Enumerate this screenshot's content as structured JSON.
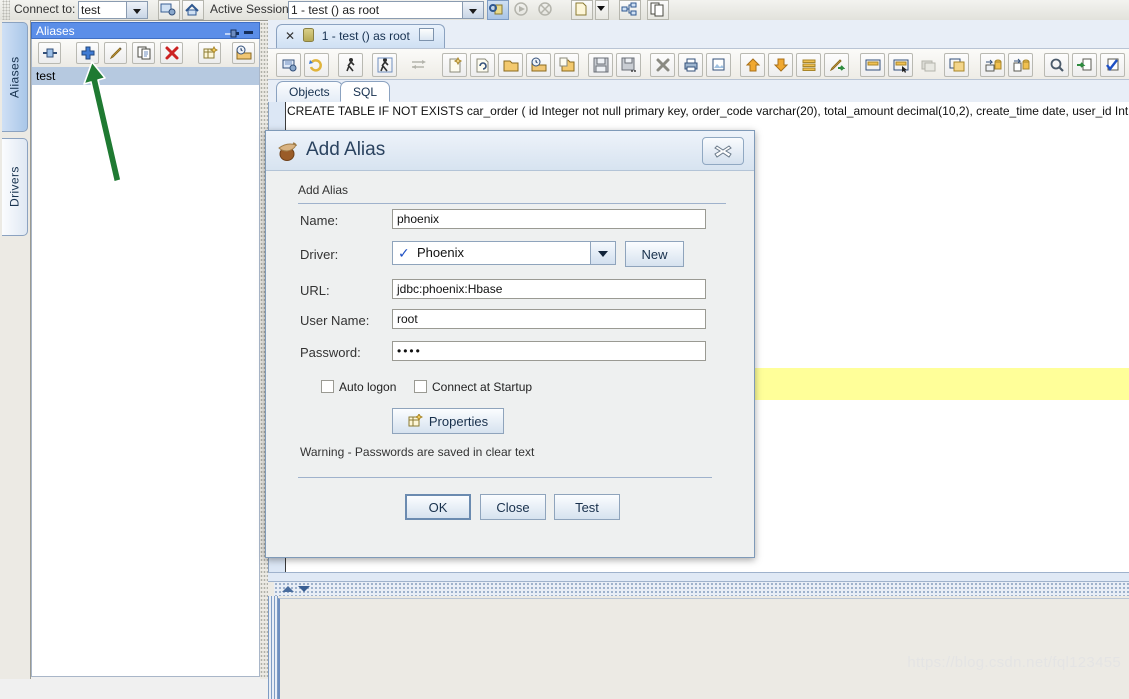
{
  "topbar": {
    "connect_label": "Connect to:",
    "connect_value": "test",
    "session_label": "Active Session:",
    "session_value": "1 - test () as root",
    "icons": [
      "connect-new-icon",
      "reconnect-icon",
      "run-icon",
      "stop-icon",
      "new-file-icon",
      "dropdown-icon",
      "hierarchy-icon",
      "copy-icon"
    ]
  },
  "vertical_tabs": [
    {
      "label": "Aliases",
      "selected": true
    },
    {
      "label": "Drivers",
      "selected": false
    }
  ],
  "aliases_panel": {
    "title": "Aliases",
    "pin_icon": "pin-icon",
    "minimize_icon": "minimize-icon",
    "toolbar_icons": [
      "connect-alias-icon",
      "add-alias-icon",
      "modify-alias-icon",
      "copy-alias-icon",
      "delete-alias-icon",
      "new-table-icon",
      "open-recent-icon"
    ],
    "items": [
      {
        "label": "test",
        "selected": true
      }
    ]
  },
  "editor": {
    "document_tab": {
      "close_icon": "close-icon",
      "db_icon": "database-icon",
      "label": "1 - test () as root",
      "window_icon": "restore-window-icon"
    },
    "toolbar_icons": [
      "connect-session-icon",
      "refresh-session-icon",
      "run-sql-icon",
      "run-current-sql-icon",
      "commit-icon",
      "new-sql-icon",
      "new-sql-wizard-icon",
      "open-file-icon",
      "open-recent-icon",
      "copy-file-icon",
      "save-icon",
      "save-as-icon",
      "close-session-icon",
      "print-icon",
      "print-preview-icon",
      "move-up-icon",
      "move-down-icon",
      "format-icon",
      "edit-script-icon",
      "panel-left-icon",
      "panel-select-icon",
      "panel-stack-icon",
      "panel-clone-icon",
      "import-db-icon",
      "export-db-icon",
      "search-icon",
      "export-results-icon",
      "validate-icon"
    ],
    "sub_tabs": [
      {
        "label": "Objects",
        "mnemonic": "O",
        "selected": false
      },
      {
        "label": "SQL",
        "mnemonic": "Q",
        "selected": true
      }
    ],
    "sql_text": "CREATE TABLE IF NOT EXISTS car_order ( id Integer not null primary key, order_code varchar(20), total_amount decimal(10,2), create_time date, user_id Int",
    "highlight_color": "#ffff99"
  },
  "results_panel": {
    "collapse_up_icon": "collapse-up-icon",
    "collapse_down_icon": "collapse-down-icon"
  },
  "dialog": {
    "icon": "acorn-icon",
    "title": "Add Alias",
    "close_icon": "close-icon",
    "group_label": "Add Alias",
    "fields": [
      {
        "label": "Name:",
        "value": "phoenix"
      },
      {
        "label": "URL:",
        "value": "jdbc:phoenix:Hbase"
      },
      {
        "label": "User Name:",
        "value": "root"
      },
      {
        "label": "Password:",
        "value": "••••"
      }
    ],
    "driver": {
      "label": "Driver:",
      "value": "Phoenix",
      "check_icon": "check-icon",
      "dropdown_icon": "chevron-down-icon",
      "new_button": "New"
    },
    "checkboxes": [
      {
        "label": "Auto logon",
        "checked": false
      },
      {
        "label": "Connect at Startup",
        "checked": false
      }
    ],
    "properties_button": {
      "label": "Properties",
      "icon": "properties-icon"
    },
    "warning_text": "Warning - Passwords are saved in clear text",
    "buttons": [
      {
        "label": "OK",
        "focused": true
      },
      {
        "label": "Close",
        "focused": false
      },
      {
        "label": "Test",
        "focused": false
      }
    ]
  },
  "annotation": {
    "arrow_color": "#1f7a32"
  },
  "watermark": "https://blog.csdn.net/fql123455"
}
